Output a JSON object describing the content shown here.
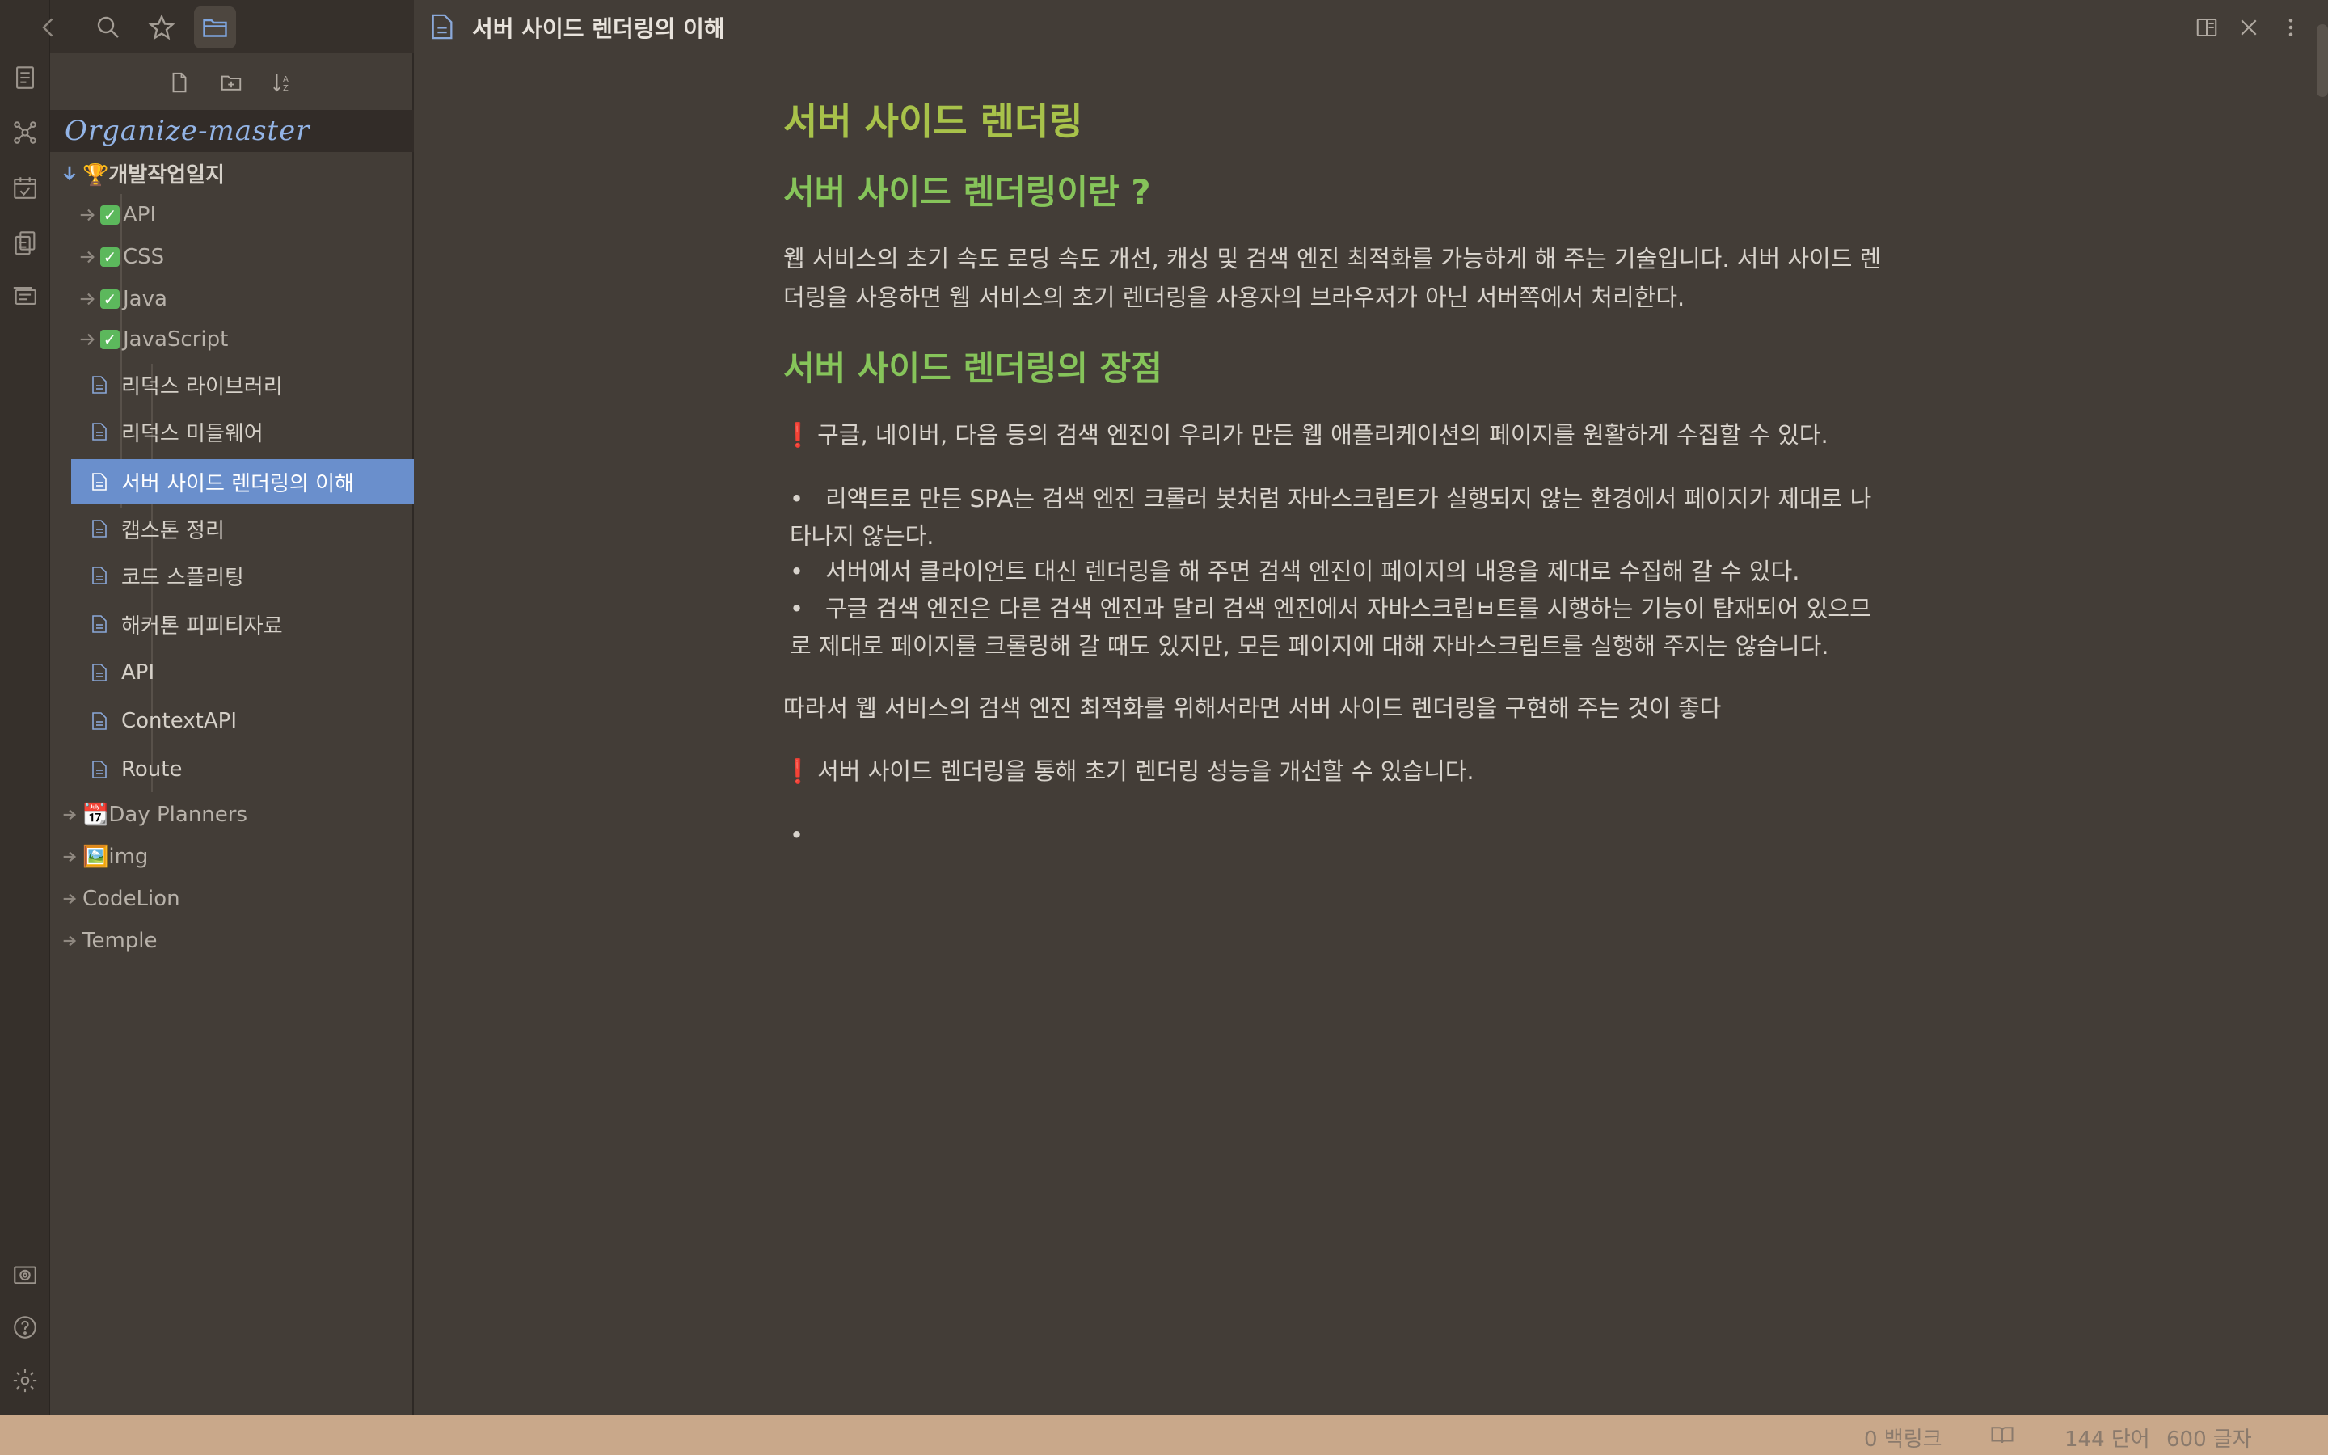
{
  "sidebar": {
    "vault_name": "Organize-master",
    "tree": [
      {
        "label": "🏆개발작업일지",
        "kind": "folder",
        "expanded": true
      },
      {
        "label": "API",
        "kind": "folder-check"
      },
      {
        "label": "CSS",
        "kind": "folder-check"
      },
      {
        "label": "Java",
        "kind": "folder-check"
      },
      {
        "label": "JavaScript",
        "kind": "folder-check"
      },
      {
        "label": "리덕스 라이브러리",
        "kind": "file"
      },
      {
        "label": "리덕스 미들웨어",
        "kind": "file"
      },
      {
        "label": "서버 사이드 렌더링의 이해",
        "kind": "file",
        "selected": true
      },
      {
        "label": "캡스톤 정리",
        "kind": "file"
      },
      {
        "label": "코드 스플리팅",
        "kind": "file"
      },
      {
        "label": "해커톤 피피티자료",
        "kind": "file"
      },
      {
        "label": "API",
        "kind": "file"
      },
      {
        "label": "ContextAPI",
        "kind": "file"
      },
      {
        "label": "Route",
        "kind": "file"
      },
      {
        "label": "📆Day Planners",
        "kind": "folder"
      },
      {
        "label": "🖼️img",
        "kind": "folder"
      },
      {
        "label": "CodeLion",
        "kind": "folder"
      },
      {
        "label": "Temple",
        "kind": "folder"
      }
    ]
  },
  "editor": {
    "view_title": "서버 사이드 렌더링의 이해",
    "h1": "서버 사이드 렌더링",
    "h2_1": "서버 사이드 렌더링이란 ?",
    "p1_line1": "웹 서비스의 초기 속도 로딩 속도 개선, 캐싱 및 검색 엔진 최적화를 가능하게 해 주는 기술입니다. 서버 사이드 렌",
    "p1_line2": "더링을 사용하면 웹 서비스의 초기 렌더링을 사용자의 브라우저가 아닌 서버쪽에서 처리한다.",
    "h2_2": "서버 사이드 렌더링의 장점",
    "callout1": "구글, 네이버, 다음 등의 검색 엔진이 우리가 만든 웹 애플리케이션의 페이지를 원활하게 수집할 수 있다.",
    "bullet1_line1": "리액트로 만든 SPA는 검색 엔진 크롤러 봇처럼 자바스크립트가 실행되지 않는 환경에서 페이지가 제대로 나",
    "bullet1_line2": "타나지 않는다.",
    "bullet2": "서버에서 클라이언트 대신 렌더링을 해 주면 검색 엔진이 페이지의 내용을 제대로 수집해 갈 수 있다.",
    "bullet3_line1": "구글 검색 엔진은 다른 검색 엔진과 달리 검색 엔진에서 자바스크립ㅂ트를 시행하는 기능이 탑재되어 있으므",
    "bullet3_line2": "로 제대로 페이지를 크롤링해 갈 때도 있지만, 모든 페이지에 대해 자바스크립트를 실행해 주지는 않습니다.",
    "p2": "따라서 웹 서비스의 검색 엔진 최적화를 위해서라면 서버 사이드 렌더링을 구현해 주는 것이 좋다",
    "callout2": "서버 사이드 렌더링을 통해 초기 렌더링 성능을 개선할 수 있습니다.",
    "bullet_marker": "•",
    "excl": "❗"
  },
  "status": {
    "backlinks": "0 백링크",
    "words": "144 단어",
    "chars": "600 글자"
  },
  "colors": {
    "background": "#433d37",
    "h1": "#a8c24a",
    "h2": "#86c45a",
    "selected": "#6a8fcc",
    "vault": "#93b4e6",
    "status_bar": "#c9a88a"
  },
  "icons": [
    "back-arrow-icon",
    "search-icon",
    "star-icon",
    "folder-icon",
    "new-note-icon",
    "new-folder-icon",
    "sort-icon",
    "file-icon",
    "graph-icon",
    "calendar-icon",
    "copy-icon",
    "slides-icon",
    "camera-icon",
    "help-icon",
    "gear-icon",
    "split-icon",
    "close-icon",
    "more-icon",
    "book-icon"
  ]
}
